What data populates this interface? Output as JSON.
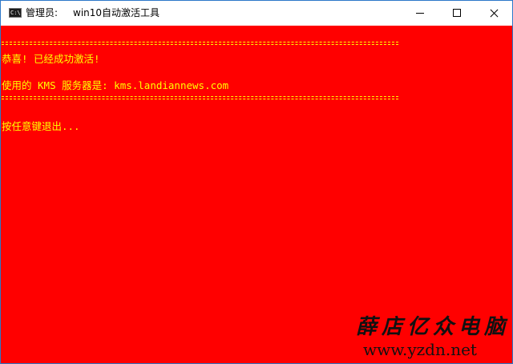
{
  "window": {
    "icon_text": "C:\\",
    "title_prefix": "管理员:",
    "title": "win10自动激活工具"
  },
  "console": {
    "background": "#ff0000",
    "text_color": "#ffff00",
    "lines": {
      "success": "恭喜! 已经成功激活!",
      "kms_server": "使用的 KMS 服务器是: kms.landiannews.com",
      "exit_prompt": "按任意键退出..."
    }
  },
  "watermark": {
    "name": "薛店亿众电脑",
    "url": "www.yzdn.net"
  }
}
